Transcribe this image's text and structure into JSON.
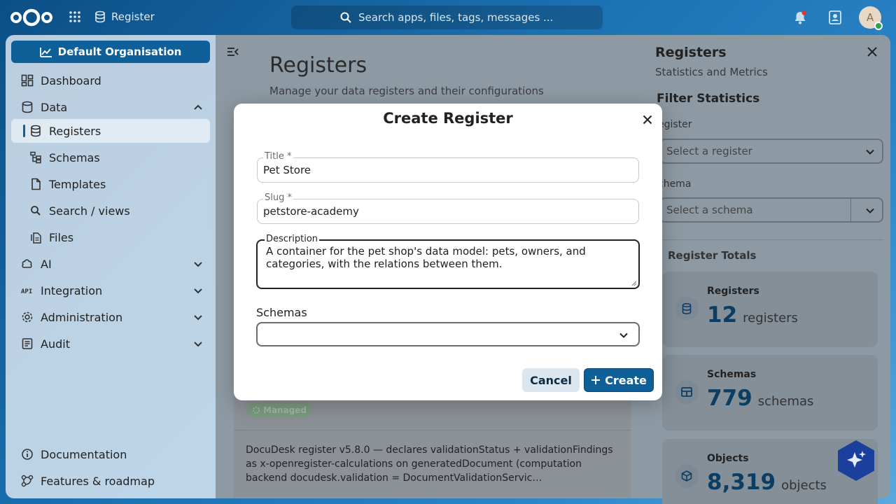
{
  "header": {
    "app_name": "Register",
    "search_placeholder": "Search apps, files, tags, messages ...",
    "avatar_initial": "A"
  },
  "sidebar": {
    "organisation_label": "Default Organisation",
    "items": [
      {
        "label": "Dashboard",
        "icon": "dashboard-icon"
      },
      {
        "label": "Data",
        "icon": "database-icon",
        "expanded": true
      },
      {
        "label": "Registers",
        "icon": "database-icon",
        "active": true
      },
      {
        "label": "Schemas",
        "icon": "schema-tree-icon"
      },
      {
        "label": "Templates",
        "icon": "file-icon"
      },
      {
        "label": "Search / views",
        "icon": "search-icon"
      },
      {
        "label": "Files",
        "icon": "files-icon"
      },
      {
        "label": "AI",
        "icon": "ai-icon"
      },
      {
        "label": "Integration",
        "icon": "api-icon"
      },
      {
        "label": "Administration",
        "icon": "gear-icon"
      },
      {
        "label": "Audit",
        "icon": "audit-icon"
      }
    ],
    "footer": [
      {
        "label": "Documentation",
        "icon": "info-icon"
      },
      {
        "label": "Features & roadmap",
        "icon": "roadmap-icon"
      }
    ]
  },
  "main": {
    "title": "Registers",
    "subtitle": "Manage your data registers and their configurations",
    "card": {
      "badge": "Managed",
      "description": "DocuDesk register v5.8.0 — declares validationStatus + validationFindings as x-openregister-calculations on generatedDocument (computation backend docudesk.validation = DocumentValidationServic…"
    }
  },
  "right_panel": {
    "title": "Registers",
    "subtitle": "Statistics and Metrics",
    "filter_heading": "Filter Statistics",
    "register_label": "egister",
    "register_placeholder": "Select a register",
    "schema_label": "chema",
    "schema_placeholder": "Select a schema",
    "totals_heading": "Register Totals",
    "stats": [
      {
        "label": "Registers",
        "value": "12",
        "unit": "registers",
        "icon": "database-icon"
      },
      {
        "label": "Schemas",
        "value": "779",
        "unit": "schemas",
        "icon": "table-icon"
      },
      {
        "label": "Objects",
        "value": "8,319",
        "unit": "objects",
        "icon": "cube-icon"
      }
    ]
  },
  "modal": {
    "title": "Create Register",
    "title_label": "Title *",
    "title_value": "Pet Store",
    "slug_label": "Slug *",
    "slug_value": "petstore-academy",
    "description_label": "Description",
    "description_value": "A container for the pet shop's data model: pets, owners, and categories, with the relations between them.",
    "schemas_label": "Schemas",
    "cancel_label": "Cancel",
    "create_label": "Create"
  },
  "colors": {
    "primary": "#0f5f99",
    "stat_number": "#0c3e64"
  }
}
